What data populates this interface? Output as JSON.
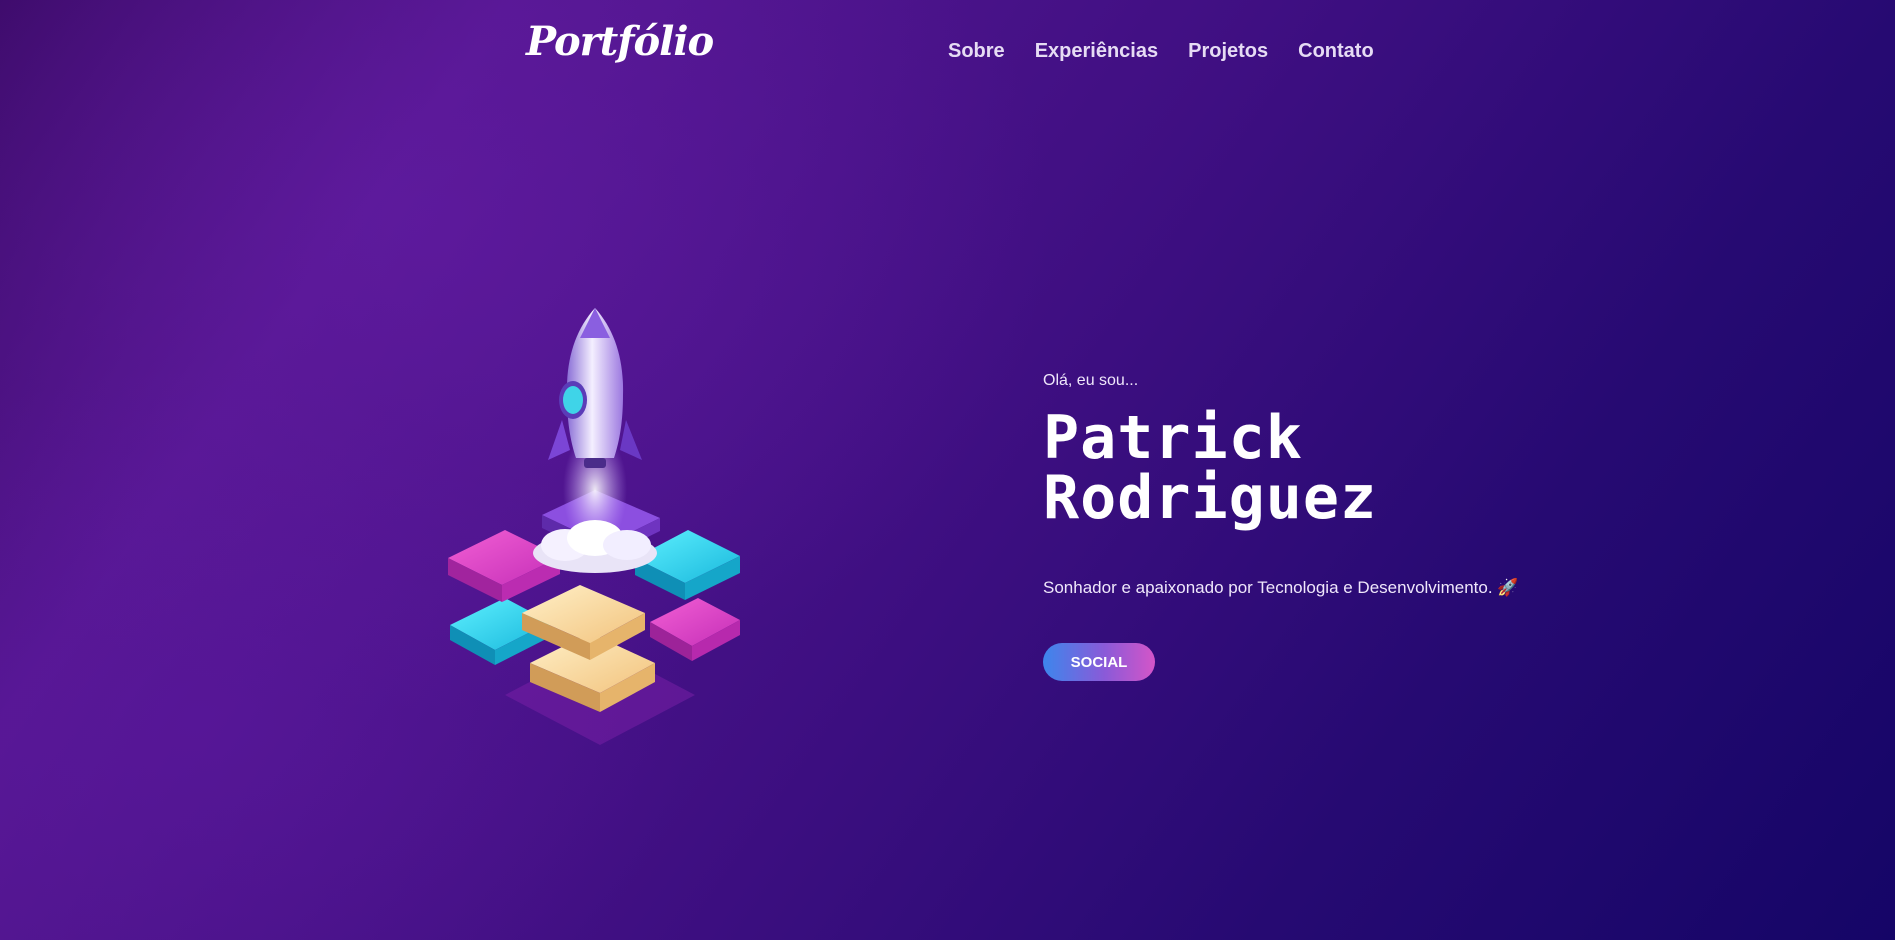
{
  "nav": {
    "logo": "Portfólio",
    "links": [
      "Sobre",
      "Experiências",
      "Projetos",
      "Contato"
    ]
  },
  "hero": {
    "greeting": "Olá, eu sou...",
    "name_first": "Patrick",
    "name_last": "Rodriguez",
    "tagline": "Sonhador e apaixonado por Tecnologia e Desenvolvimento. 🚀",
    "social_label": "SOCIAL",
    "illustration": "rocket-launch-puzzle-illustration"
  },
  "colors": {
    "background_start": "#3a0a66",
    "background_end": "#150567",
    "button_gradient_start": "#3d86ec",
    "button_gradient_end": "#d455c8",
    "puzzle_pink": "#e040c8",
    "puzzle_cyan": "#27d8ee",
    "puzzle_yellow": "#f8d79a"
  }
}
